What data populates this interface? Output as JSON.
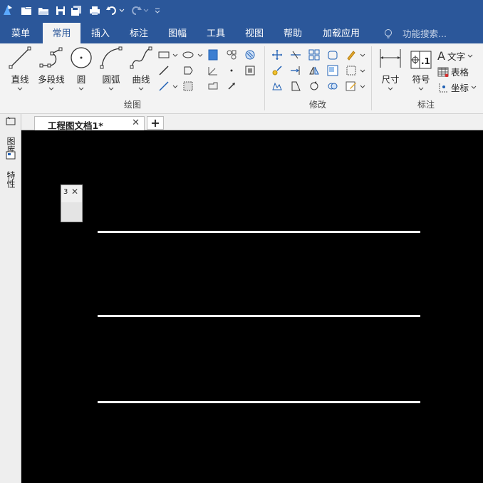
{
  "menu": {
    "tabs": [
      {
        "label": "菜单"
      },
      {
        "label": "常用"
      },
      {
        "label": "插入"
      },
      {
        "label": "标注"
      },
      {
        "label": "图幅"
      },
      {
        "label": "工具"
      },
      {
        "label": "视图"
      },
      {
        "label": "帮助"
      },
      {
        "label": "加载应用"
      }
    ],
    "active_tab": "常用",
    "search_placeholder": "功能搜索..."
  },
  "ribbon": {
    "draw_group": {
      "label": "绘图",
      "line": "直线",
      "polyline": "多段线",
      "circle": "圆",
      "arc": "圆弧",
      "curve": "曲线"
    },
    "modify_group": {
      "label": "修改"
    },
    "annotate_group": {
      "label": "标注",
      "dimension": "尺寸",
      "symbol": "符号",
      "symbol_icon_text": ".1",
      "text": "文字",
      "table": "表格",
      "coordinate": "坐标"
    }
  },
  "side_panel": {
    "library_tab": "图库",
    "properties_tab": "特性"
  },
  "document_tabs": [
    {
      "label": "工程图文档1*"
    }
  ],
  "add_tab_label": "+",
  "floating_panel": {
    "label": "3"
  },
  "colors": {
    "title_bar": "#2b579a",
    "ribbon_bg": "#f3f3f3",
    "canvas_bg": "#000000",
    "drawing_lines": "#ffffff",
    "accent_blue": "#1e5fb4"
  }
}
